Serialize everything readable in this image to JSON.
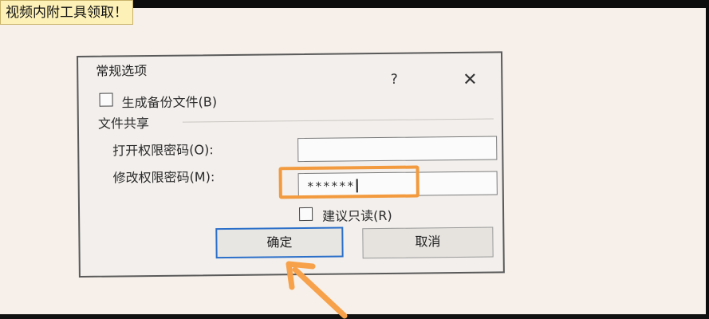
{
  "caption": "视频内附工具领取！",
  "dialog": {
    "title": "常规选项",
    "help_label": "?",
    "close_label": "✕",
    "backup_checkbox_label": "生成备份文件(B)",
    "group_label": "文件共享",
    "open_password_label": "打开权限密码(O):",
    "open_password_value": "",
    "modify_password_label": "修改权限密码(M):",
    "modify_password_value": "******",
    "readonly_checkbox_label": "建议只读(R)",
    "ok_label": "确定",
    "cancel_label": "取消"
  },
  "colors": {
    "highlight": "#f29a3d",
    "arrow": "#f7a14a",
    "ok_border": "#2a6fc9"
  }
}
